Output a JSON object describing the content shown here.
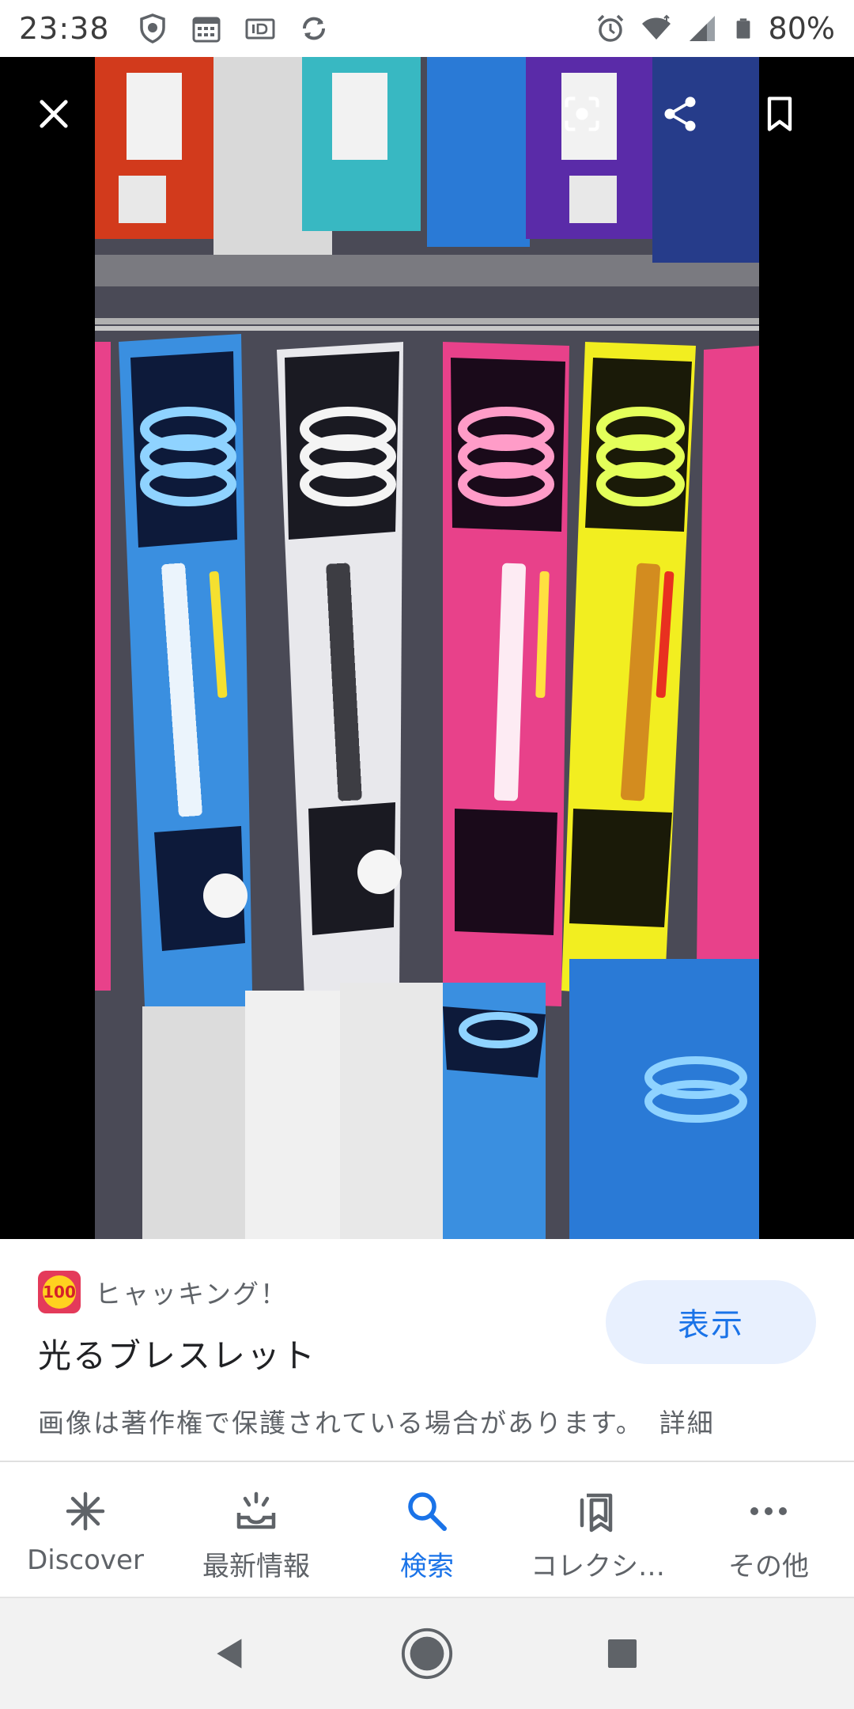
{
  "status_bar": {
    "time": "23:38",
    "battery": "80%",
    "icons": [
      "shield-icon",
      "calendar-icon",
      "id-icon",
      "sync-icon",
      "alarm-icon",
      "wifi-icon",
      "signal-icon",
      "battery-icon"
    ]
  },
  "viewer": {
    "close_icon": "close-icon",
    "lens_icon": "lens-icon",
    "share_icon": "share-icon",
    "bookmark_icon": "bookmark-icon"
  },
  "info": {
    "source_logo_text": "100",
    "source_name": "ヒャッキング！",
    "title": "光るブレスレット",
    "view_button": "表示",
    "copyright": "画像は著作権で保護されている場合があります。",
    "details_link": "詳細"
  },
  "bottom_nav": {
    "items": [
      {
        "label": "Discover",
        "icon": "asterisk-icon",
        "active": false
      },
      {
        "label": "最新情報",
        "icon": "updates-icon",
        "active": false
      },
      {
        "label": "検索",
        "icon": "search-icon",
        "active": true
      },
      {
        "label": "コレクシ…",
        "icon": "collections-icon",
        "active": false
      },
      {
        "label": "その他",
        "icon": "more-icon",
        "active": false
      }
    ]
  },
  "colors": {
    "accent": "#1a73e8",
    "button_bg": "#e8f0fe",
    "text_primary": "#202124",
    "text_secondary": "#5f6368"
  }
}
